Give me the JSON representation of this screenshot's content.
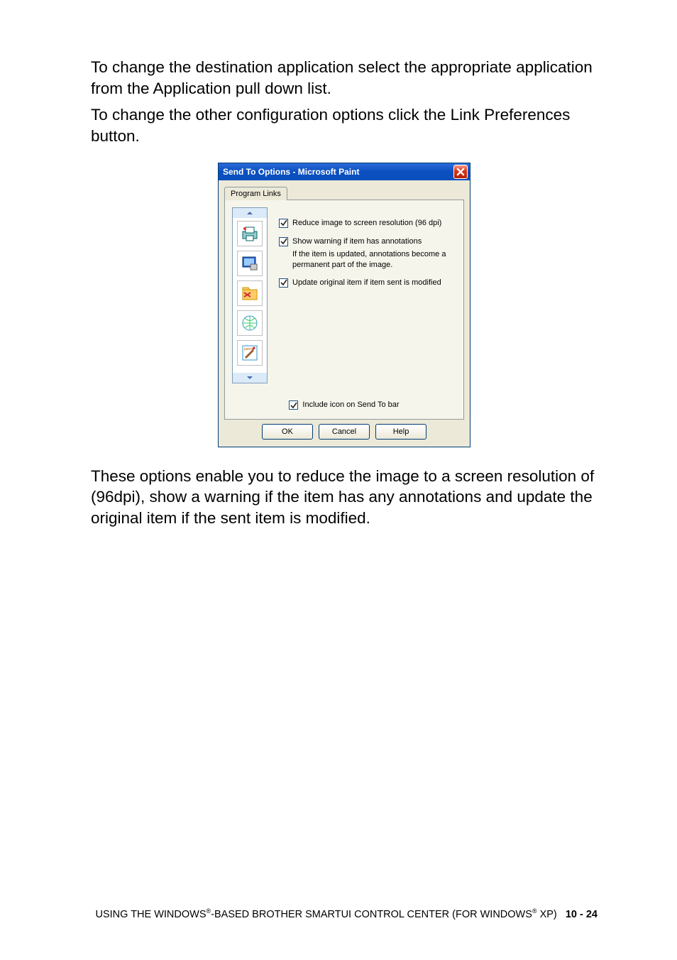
{
  "paragraphs": {
    "p1": "To change the destination application select the appropriate application from the Application pull down list.",
    "p2": "To change the other configuration options click the Link Preferences button.",
    "p3": "These options enable you to reduce the image to a screen resolution of (96dpi), show a warning if the item has any annotations and update the original item if the sent item is modified."
  },
  "dialog": {
    "title": "Send To Options - Microsoft Paint",
    "tab": "Program Links",
    "options": {
      "reduce": "Reduce image to screen resolution (96 dpi)",
      "showWarning": "Show warning if item has annotations",
      "warningNote": "If the item is updated, annotations become a permanent part of the image.",
      "update": "Update original item if item sent is modified",
      "includeIcon": "Include icon on Send To bar"
    },
    "buttons": {
      "ok": "OK",
      "cancel": "Cancel",
      "help": "Help"
    }
  },
  "footer": {
    "prefix": "USING THE WINDOWS",
    "reg": "®",
    "mid1": "-BASED BROTHER SMARTUI CONTROL CENTER (FOR WINDOWS",
    "mid2": " XP)",
    "page": "10 - 24"
  }
}
